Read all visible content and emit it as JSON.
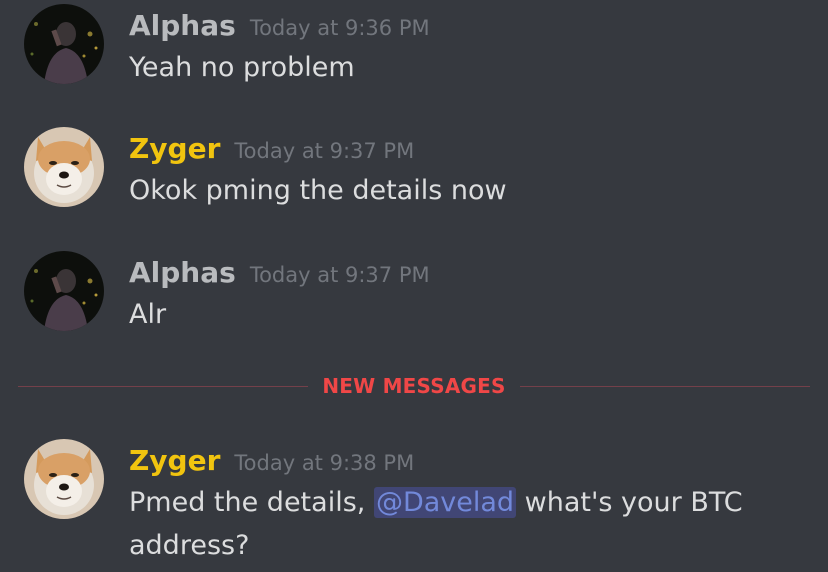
{
  "users": {
    "alphas": {
      "name": "Alphas",
      "color": "#b9bbbe"
    },
    "zyger": {
      "name": "Zyger",
      "color": "#f1c40f"
    }
  },
  "messages": [
    {
      "author": "Alphas",
      "timestamp": "Today at 9:36 PM",
      "text": "Yeah no problem"
    },
    {
      "author": "Zyger",
      "timestamp": "Today at 9:37 PM",
      "text": "Okok pming the details now"
    },
    {
      "author": "Alphas",
      "timestamp": "Today at 9:37 PM",
      "text": "Alr"
    },
    {
      "author": "Zyger",
      "timestamp": "Today at 9:38 PM",
      "text_before": "Pmed the details, ",
      "mention": "@Davelad",
      "text_after": " what's your BTC address?"
    }
  ],
  "divider": {
    "label": "NEW MESSAGES",
    "color": "#f04747"
  },
  "colors": {
    "background": "#36393f",
    "text": "#dcddde",
    "timestamp": "#72767d",
    "mention_bg": "#414675",
    "mention_text": "#7289da"
  }
}
